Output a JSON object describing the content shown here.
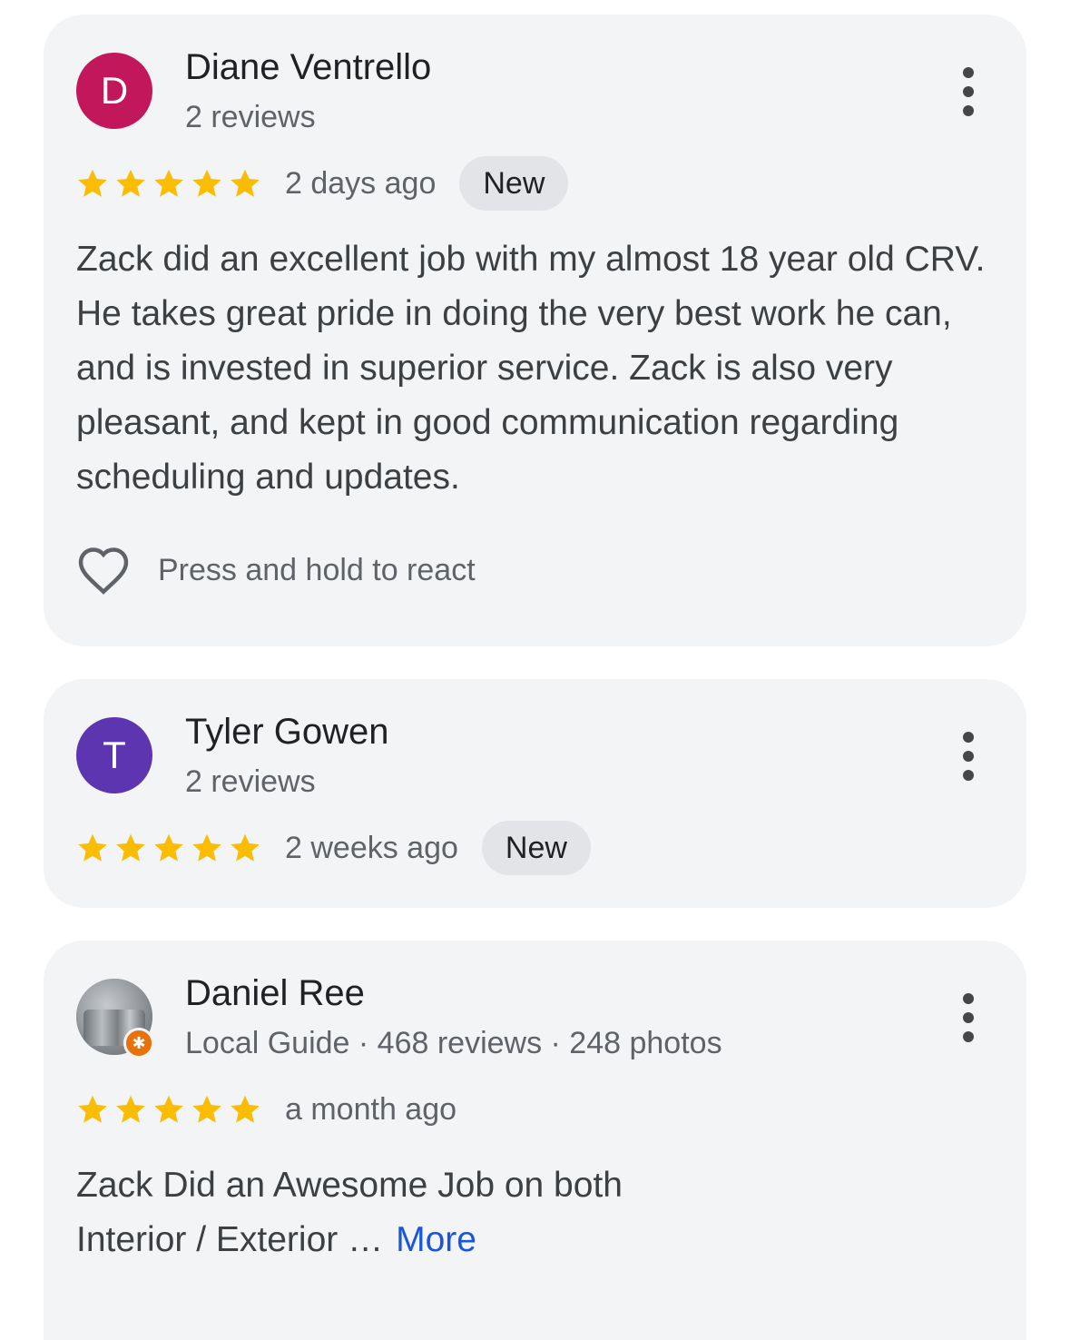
{
  "reviews": [
    {
      "avatar_letter": "D",
      "avatar_color": "#c2185b",
      "name": "Diane Ventrello",
      "meta": "2 reviews",
      "stars": 5,
      "time": "2 days ago",
      "badge": "New",
      "text": "Zack did an excellent job with my almost 18 year old CRV. He takes great pride in doing the very best work he can, and is invested in superior service. Zack is also very pleasant, and kept in good communication regarding scheduling and updates.",
      "react_label": "Press and hold to react",
      "menu_icon": "more-vert-icon"
    },
    {
      "avatar_letter": "T",
      "avatar_color": "#5e35b1",
      "name": "Tyler Gowen",
      "meta": "2 reviews",
      "stars": 5,
      "time": "2 weeks ago",
      "badge": "New",
      "menu_icon": "more-vert-icon"
    },
    {
      "avatar_image": "profile-photo",
      "local_guide_badge_color": "#e8710a",
      "name": "Daniel Ree",
      "meta": "Local Guide · 468 reviews · 248 photos",
      "stars": 5,
      "time": "a month ago",
      "text_line1": "Zack Did an Awesome Job on both",
      "text_line2": "Interior / Exterior …",
      "more_label": "More",
      "menu_icon": "more-vert-icon"
    }
  ],
  "colors": {
    "star": "#fbbc04",
    "link": "#1a56db",
    "card_bg": "#f3f4f6",
    "badge_bg": "#e2e4e7"
  }
}
